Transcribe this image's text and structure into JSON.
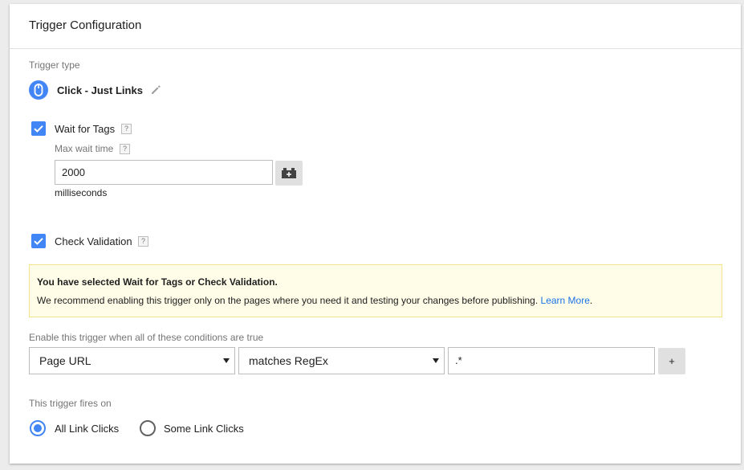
{
  "header": {
    "title": "Trigger Configuration"
  },
  "trigger_type": {
    "label": "Trigger type",
    "name": "Click - Just Links",
    "icon": "mouse-icon",
    "accent": "#4285f4"
  },
  "wait_for_tags": {
    "label": "Wait for Tags",
    "checked": true,
    "help": "?",
    "max_wait_label": "Max wait time",
    "max_wait_help": "?",
    "max_wait_value": "2000",
    "unit": "milliseconds"
  },
  "check_validation": {
    "label": "Check Validation",
    "checked": true,
    "help": "?"
  },
  "notice": {
    "title": "You have selected Wait for Tags or Check Validation.",
    "body": "We recommend enabling this trigger only on the pages where you need it and testing your changes before publishing.",
    "link": "Learn More",
    "trailing": "."
  },
  "conditions": {
    "label": "Enable this trigger when all of these conditions are true",
    "variable": "Page URL",
    "operator": "matches RegEx",
    "value": ".*",
    "add_label": "+"
  },
  "fires_on": {
    "label": "This trigger fires on",
    "options": [
      {
        "label": "All Link Clicks",
        "selected": true
      },
      {
        "label": "Some Link Clicks",
        "selected": false
      }
    ]
  }
}
